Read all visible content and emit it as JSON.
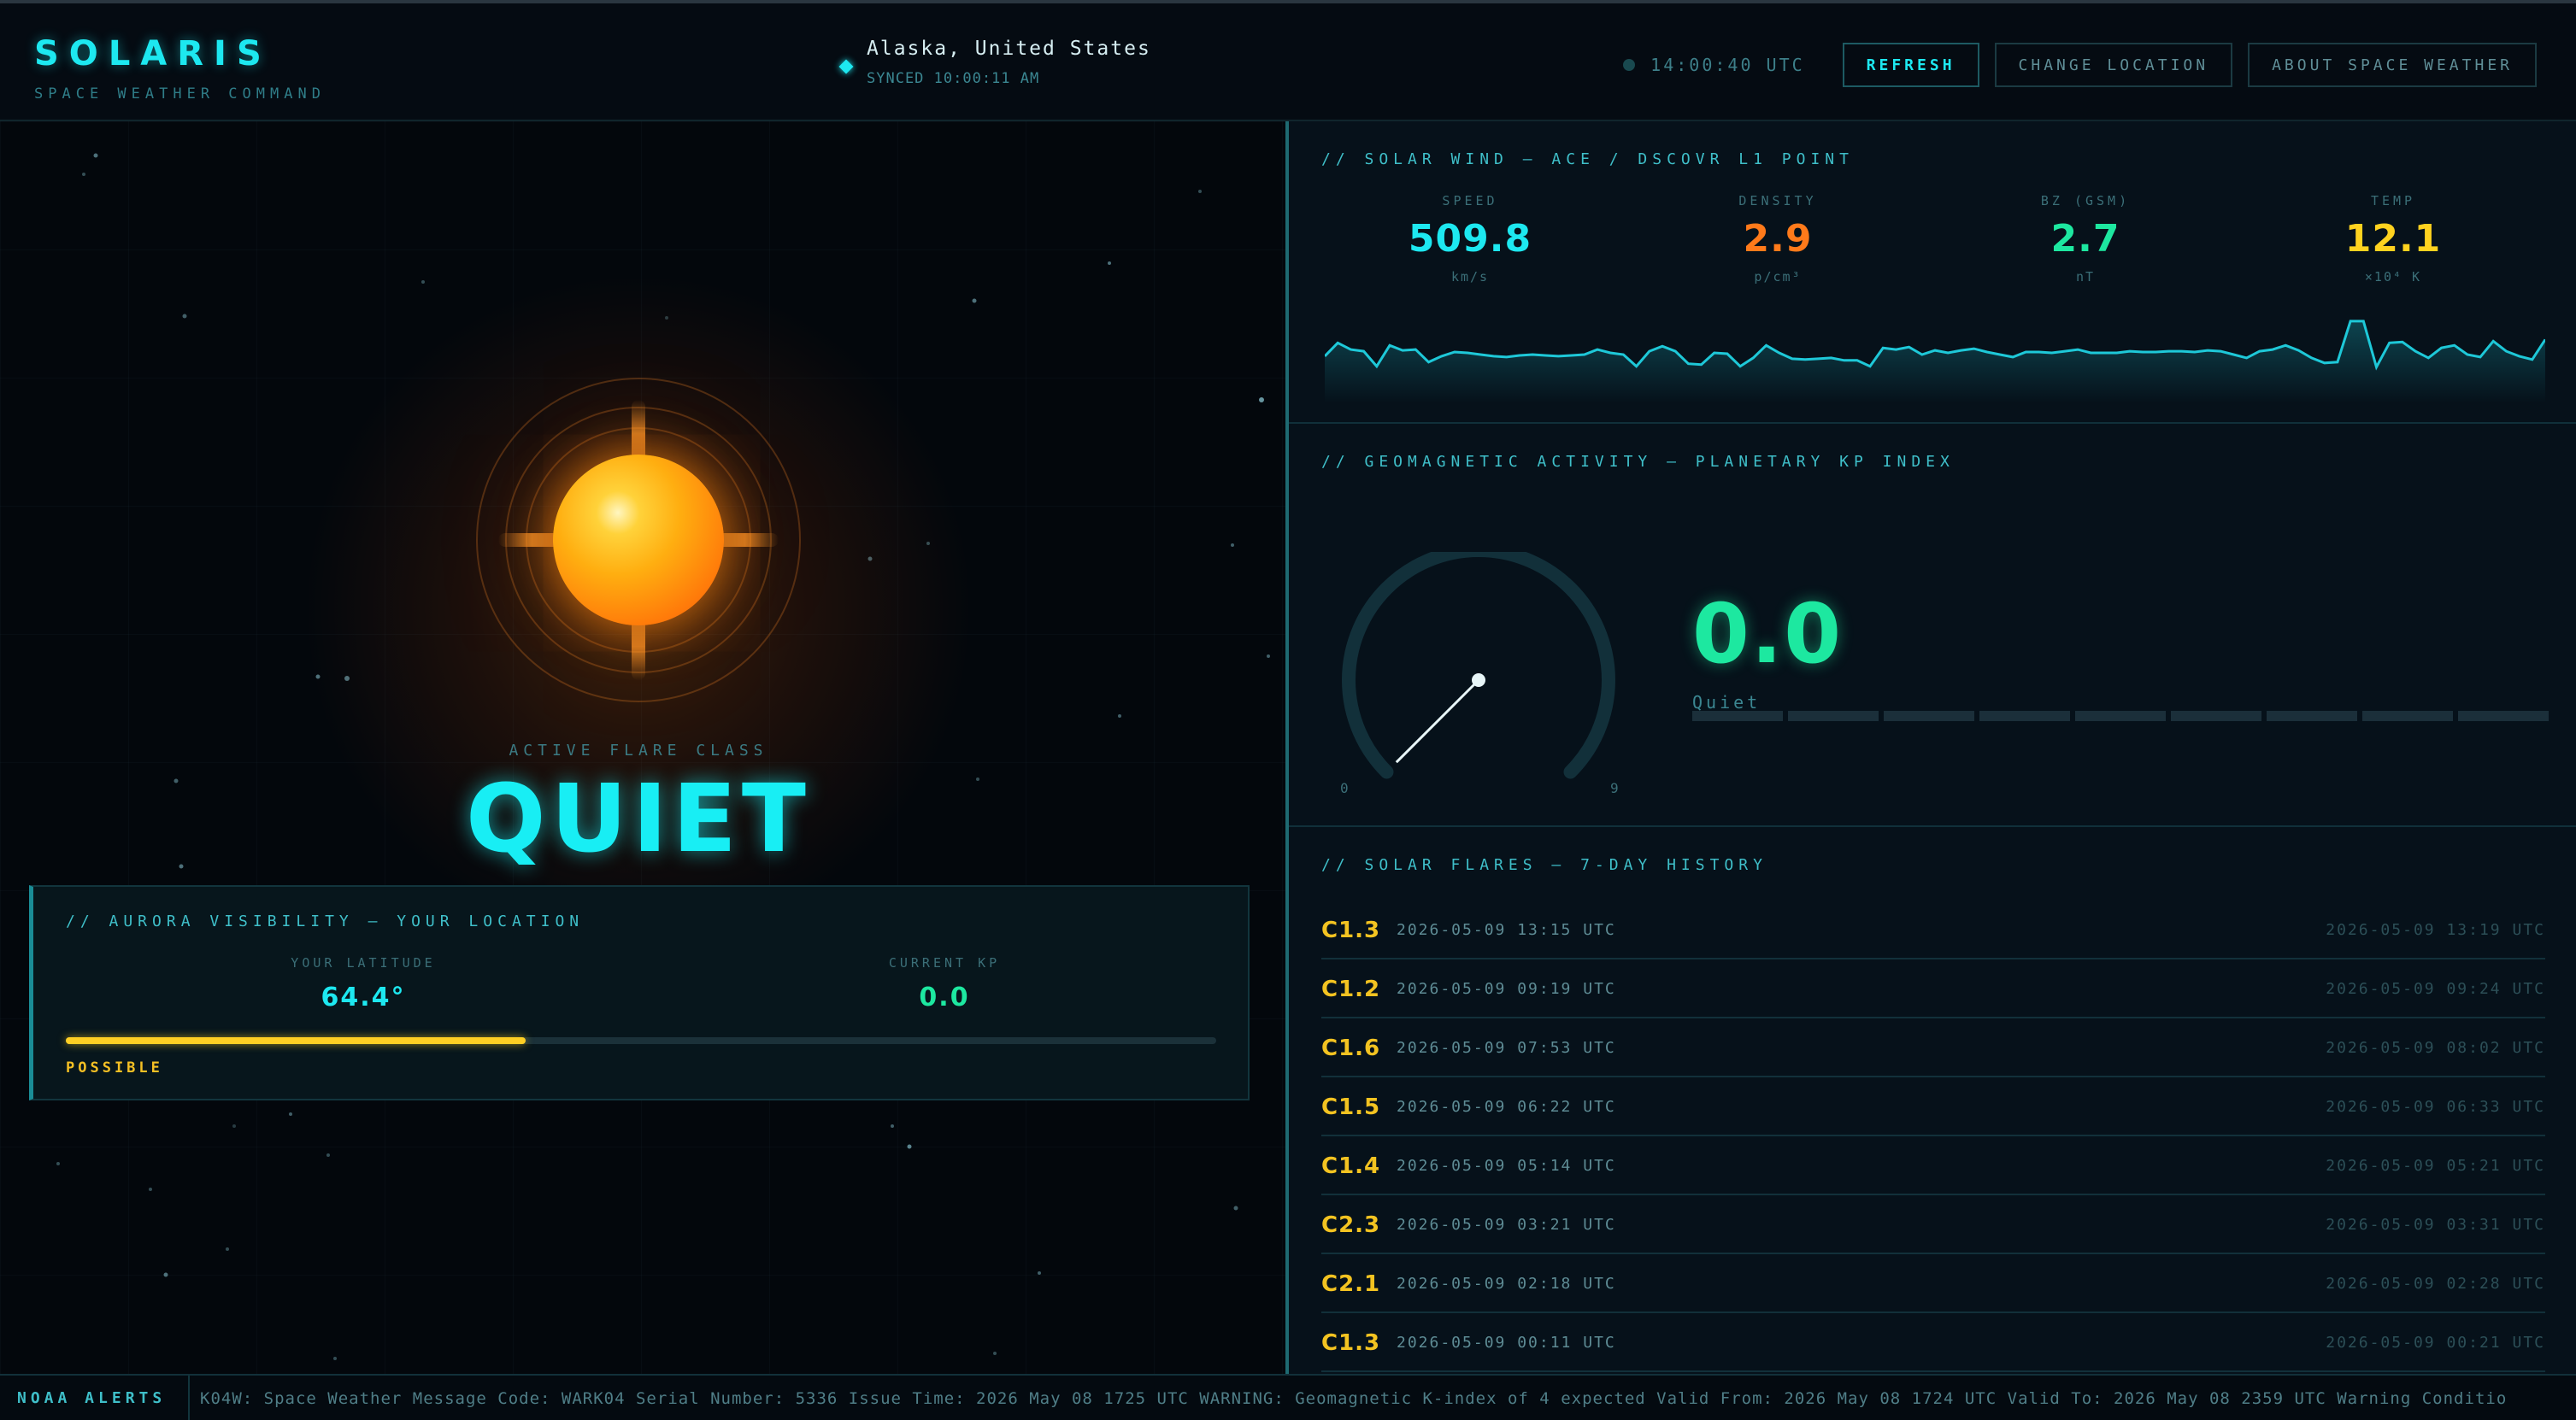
{
  "header": {
    "brand": "SOLARIS",
    "subtitle": "SPACE WEATHER COMMAND",
    "location": "Alaska, United States",
    "synced": "SYNCED 10:00:11 AM",
    "utc_time": "14:00:40 UTC",
    "buttons": {
      "refresh": "REFRESH",
      "change_location": "CHANGE LOCATION",
      "about": "ABOUT SPACE WEATHER"
    }
  },
  "flare_panel": {
    "label": "ACTIVE FLARE CLASS",
    "class": "QUIET"
  },
  "aurora": {
    "title": "// AURORA VISIBILITY — YOUR LOCATION",
    "latitude_label": "YOUR LATITUDE",
    "latitude": "64.4°",
    "kp_label": "CURRENT KP",
    "kp": "0.0",
    "visibility_fraction": 0.4,
    "status": "POSSIBLE"
  },
  "solar_wind": {
    "title": "// SOLAR WIND — ACE / DSCOVR L1 POINT",
    "stats": [
      {
        "label": "SPEED",
        "value": "509.8",
        "unit": "km/s",
        "color": "#1de8f0"
      },
      {
        "label": "DENSITY",
        "value": "2.9",
        "unit": "p/cm³",
        "color": "#ff7a1a"
      },
      {
        "label": "BZ (GSM)",
        "value": "2.7",
        "unit": "nT",
        "color": "#1de8a0"
      },
      {
        "label": "TEMP",
        "value": "12.1",
        "unit": "×10⁴ K",
        "color": "#ffd21f"
      }
    ],
    "speed_series": [
      42,
      58,
      50,
      48,
      30,
      55,
      49,
      50,
      35,
      42,
      47,
      46,
      44,
      42,
      41,
      43,
      44,
      43,
      42,
      43,
      44,
      50,
      46,
      44,
      30,
      48,
      54,
      48,
      33,
      32,
      46,
      45,
      30,
      40,
      55,
      46,
      39,
      38,
      39,
      40,
      37,
      37,
      30,
      52,
      50,
      53,
      44,
      49,
      46,
      49,
      51,
      47,
      44,
      41,
      47,
      47,
      46,
      48,
      50,
      46,
      46,
      46,
      48,
      47,
      47,
      48,
      48,
      47,
      49,
      48,
      44,
      40,
      48,
      50,
      55,
      49,
      40,
      34,
      35,
      84,
      84,
      29,
      58,
      59,
      48,
      40,
      52,
      55,
      44,
      41,
      60,
      48,
      42,
      38,
      62
    ],
    "color": "#1ec8d8"
  },
  "kp_index": {
    "title": "// GEOMAGNETIC ACTIVITY — PLANETARY KP INDEX",
    "value": "0.0",
    "kp_numeric": 0.0,
    "status": "Quiet",
    "gauge_min": "0",
    "gauge_max": "9",
    "segments": 9,
    "accent": "#1de8a0"
  },
  "flares": {
    "title": "// SOLAR FLARES — 7-DAY HISTORY",
    "rows": [
      {
        "class": "C1.3",
        "start": "2026-05-09 13:15 UTC",
        "end": "2026-05-09 13:19 UTC"
      },
      {
        "class": "C1.2",
        "start": "2026-05-09 09:19 UTC",
        "end": "2026-05-09 09:24 UTC"
      },
      {
        "class": "C1.6",
        "start": "2026-05-09 07:53 UTC",
        "end": "2026-05-09 08:02 UTC"
      },
      {
        "class": "C1.5",
        "start": "2026-05-09 06:22 UTC",
        "end": "2026-05-09 06:33 UTC"
      },
      {
        "class": "C1.4",
        "start": "2026-05-09 05:14 UTC",
        "end": "2026-05-09 05:21 UTC"
      },
      {
        "class": "C2.3",
        "start": "2026-05-09 03:21 UTC",
        "end": "2026-05-09 03:31 UTC"
      },
      {
        "class": "C2.1",
        "start": "2026-05-09 02:18 UTC",
        "end": "2026-05-09 02:28 UTC"
      },
      {
        "class": "C1.3",
        "start": "2026-05-09 00:11 UTC",
        "end": "2026-05-09 00:21 UTC"
      }
    ]
  },
  "ticker": {
    "label": "NOAA ALERTS",
    "text": "K04W: Space Weather Message Code: WARK04 Serial Number: 5336 Issue Time: 2026 May 08 1725 UTC WARNING: Geomagnetic K-index of 4 expected Valid From: 2026 May 08 1724 UTC Valid To: 2026 May 08 2359 UTC Warning Conditio"
  },
  "colors": {
    "cyan": "#1de8f0",
    "green": "#1de8a0",
    "yellow": "#f3c321",
    "orange": "#ff7a1a"
  }
}
